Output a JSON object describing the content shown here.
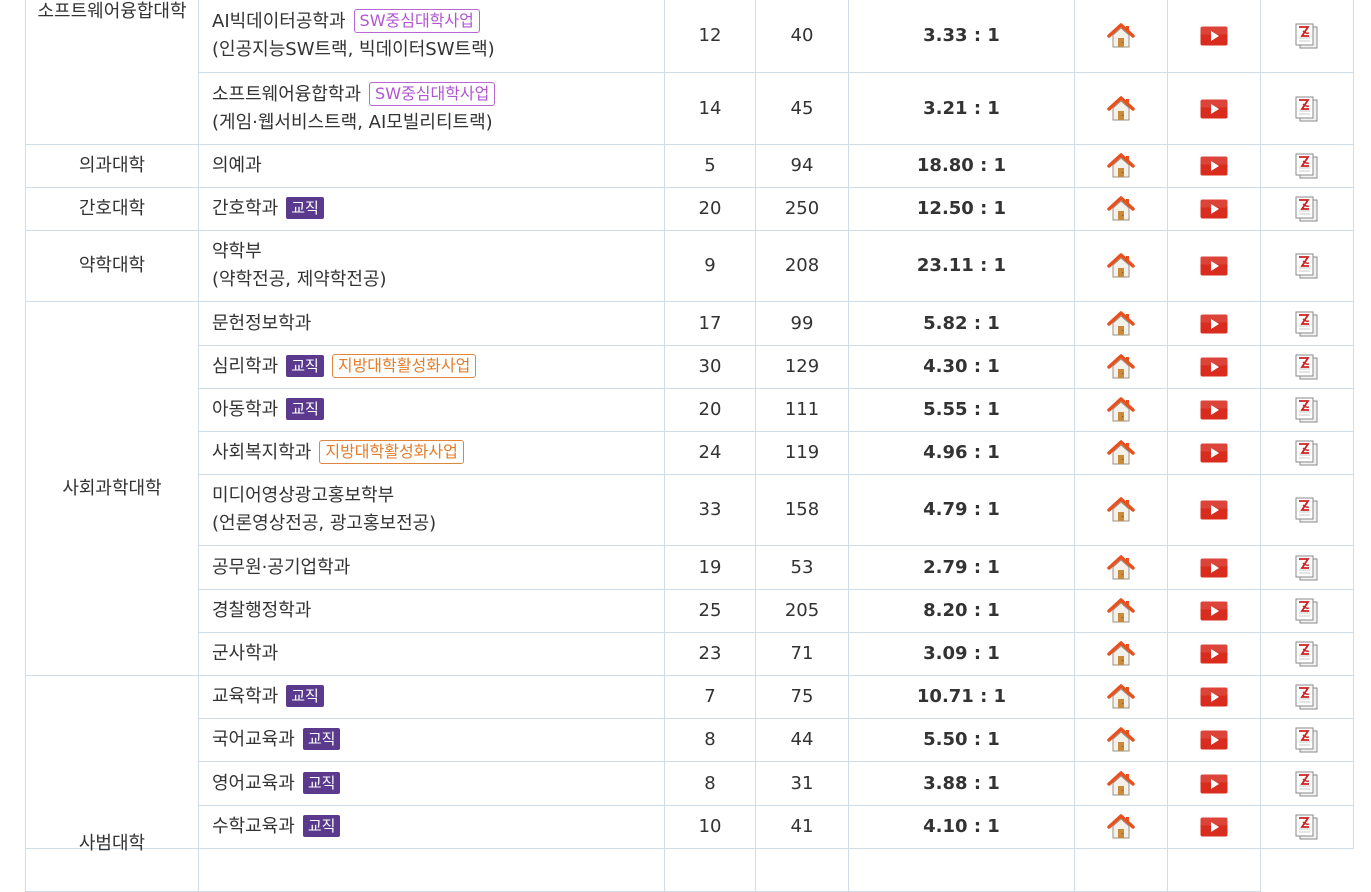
{
  "colors": {
    "border": "#cfdde8",
    "badge_edu_bg": "#5b3a8e",
    "badge_sw": "#b156d3",
    "badge_local": "#e37d2b",
    "home_icon": "#e8501e",
    "video_icon": "#d92b1e",
    "pdf_icon": "#cc2222"
  },
  "icons": [
    "home-icon",
    "play-video-icon",
    "pdf-document-icon"
  ],
  "colleges": {
    "software": "소프트웨어융합대학",
    "medicine": "의과대학",
    "nursing": "간호대학",
    "pharmacy": "약학대학",
    "social": "사회과학대학",
    "education": "사범대학"
  },
  "rows": [
    {
      "dept": "AI빅데이터공학과",
      "sub": "(인공지능SW트랙, 빅데이터SW트랙)",
      "badge": "SW중심대학사업",
      "quota": "12",
      "applicants": "40",
      "ratio": "3.33 : 1"
    },
    {
      "dept": "소프트웨어융합학과",
      "sub": "(게임·웹서비스트랙, AI모빌리티트랙)",
      "badge": "SW중심대학사업",
      "quota": "14",
      "applicants": "45",
      "ratio": "3.21 : 1"
    },
    {
      "dept": "의예과",
      "quota": "5",
      "applicants": "94",
      "ratio": "18.80 : 1"
    },
    {
      "dept": "간호학과",
      "badge": "교직",
      "quota": "20",
      "applicants": "250",
      "ratio": "12.50 : 1"
    },
    {
      "dept": "약학부",
      "sub": "(약학전공, 제약학전공)",
      "quota": "9",
      "applicants": "208",
      "ratio": "23.11 : 1"
    },
    {
      "dept": "문헌정보학과",
      "quota": "17",
      "applicants": "99",
      "ratio": "5.82 : 1"
    },
    {
      "dept": "심리학과",
      "badge": "교직",
      "badge2": "지방대학활성화사업",
      "quota": "30",
      "applicants": "129",
      "ratio": "4.30 : 1"
    },
    {
      "dept": "아동학과",
      "badge": "교직",
      "quota": "20",
      "applicants": "111",
      "ratio": "5.55 : 1"
    },
    {
      "dept": "사회복지학과",
      "badge": "지방대학활성화사업",
      "quota": "24",
      "applicants": "119",
      "ratio": "4.96 : 1"
    },
    {
      "dept": "미디어영상광고홍보학부",
      "sub": "(언론영상전공, 광고홍보전공)",
      "quota": "33",
      "applicants": "158",
      "ratio": "4.79 : 1"
    },
    {
      "dept": "공무원·공기업학과",
      "quota": "19",
      "applicants": "53",
      "ratio": "2.79 : 1"
    },
    {
      "dept": "경찰행정학과",
      "quota": "25",
      "applicants": "205",
      "ratio": "8.20 : 1"
    },
    {
      "dept": "군사학과",
      "quota": "23",
      "applicants": "71",
      "ratio": "3.09 : 1"
    },
    {
      "dept": "교육학과",
      "badge": "교직",
      "quota": "7",
      "applicants": "75",
      "ratio": "10.71 : 1"
    },
    {
      "dept": "국어교육과",
      "badge": "교직",
      "quota": "8",
      "applicants": "44",
      "ratio": "5.50 : 1"
    },
    {
      "dept": "영어교육과",
      "badge": "교직",
      "quota": "8",
      "applicants": "31",
      "ratio": "3.88 : 1"
    },
    {
      "dept": "수학교육과",
      "badge": "교직",
      "quota": "10",
      "applicants": "41",
      "ratio": "4.10 : 1"
    }
  ]
}
